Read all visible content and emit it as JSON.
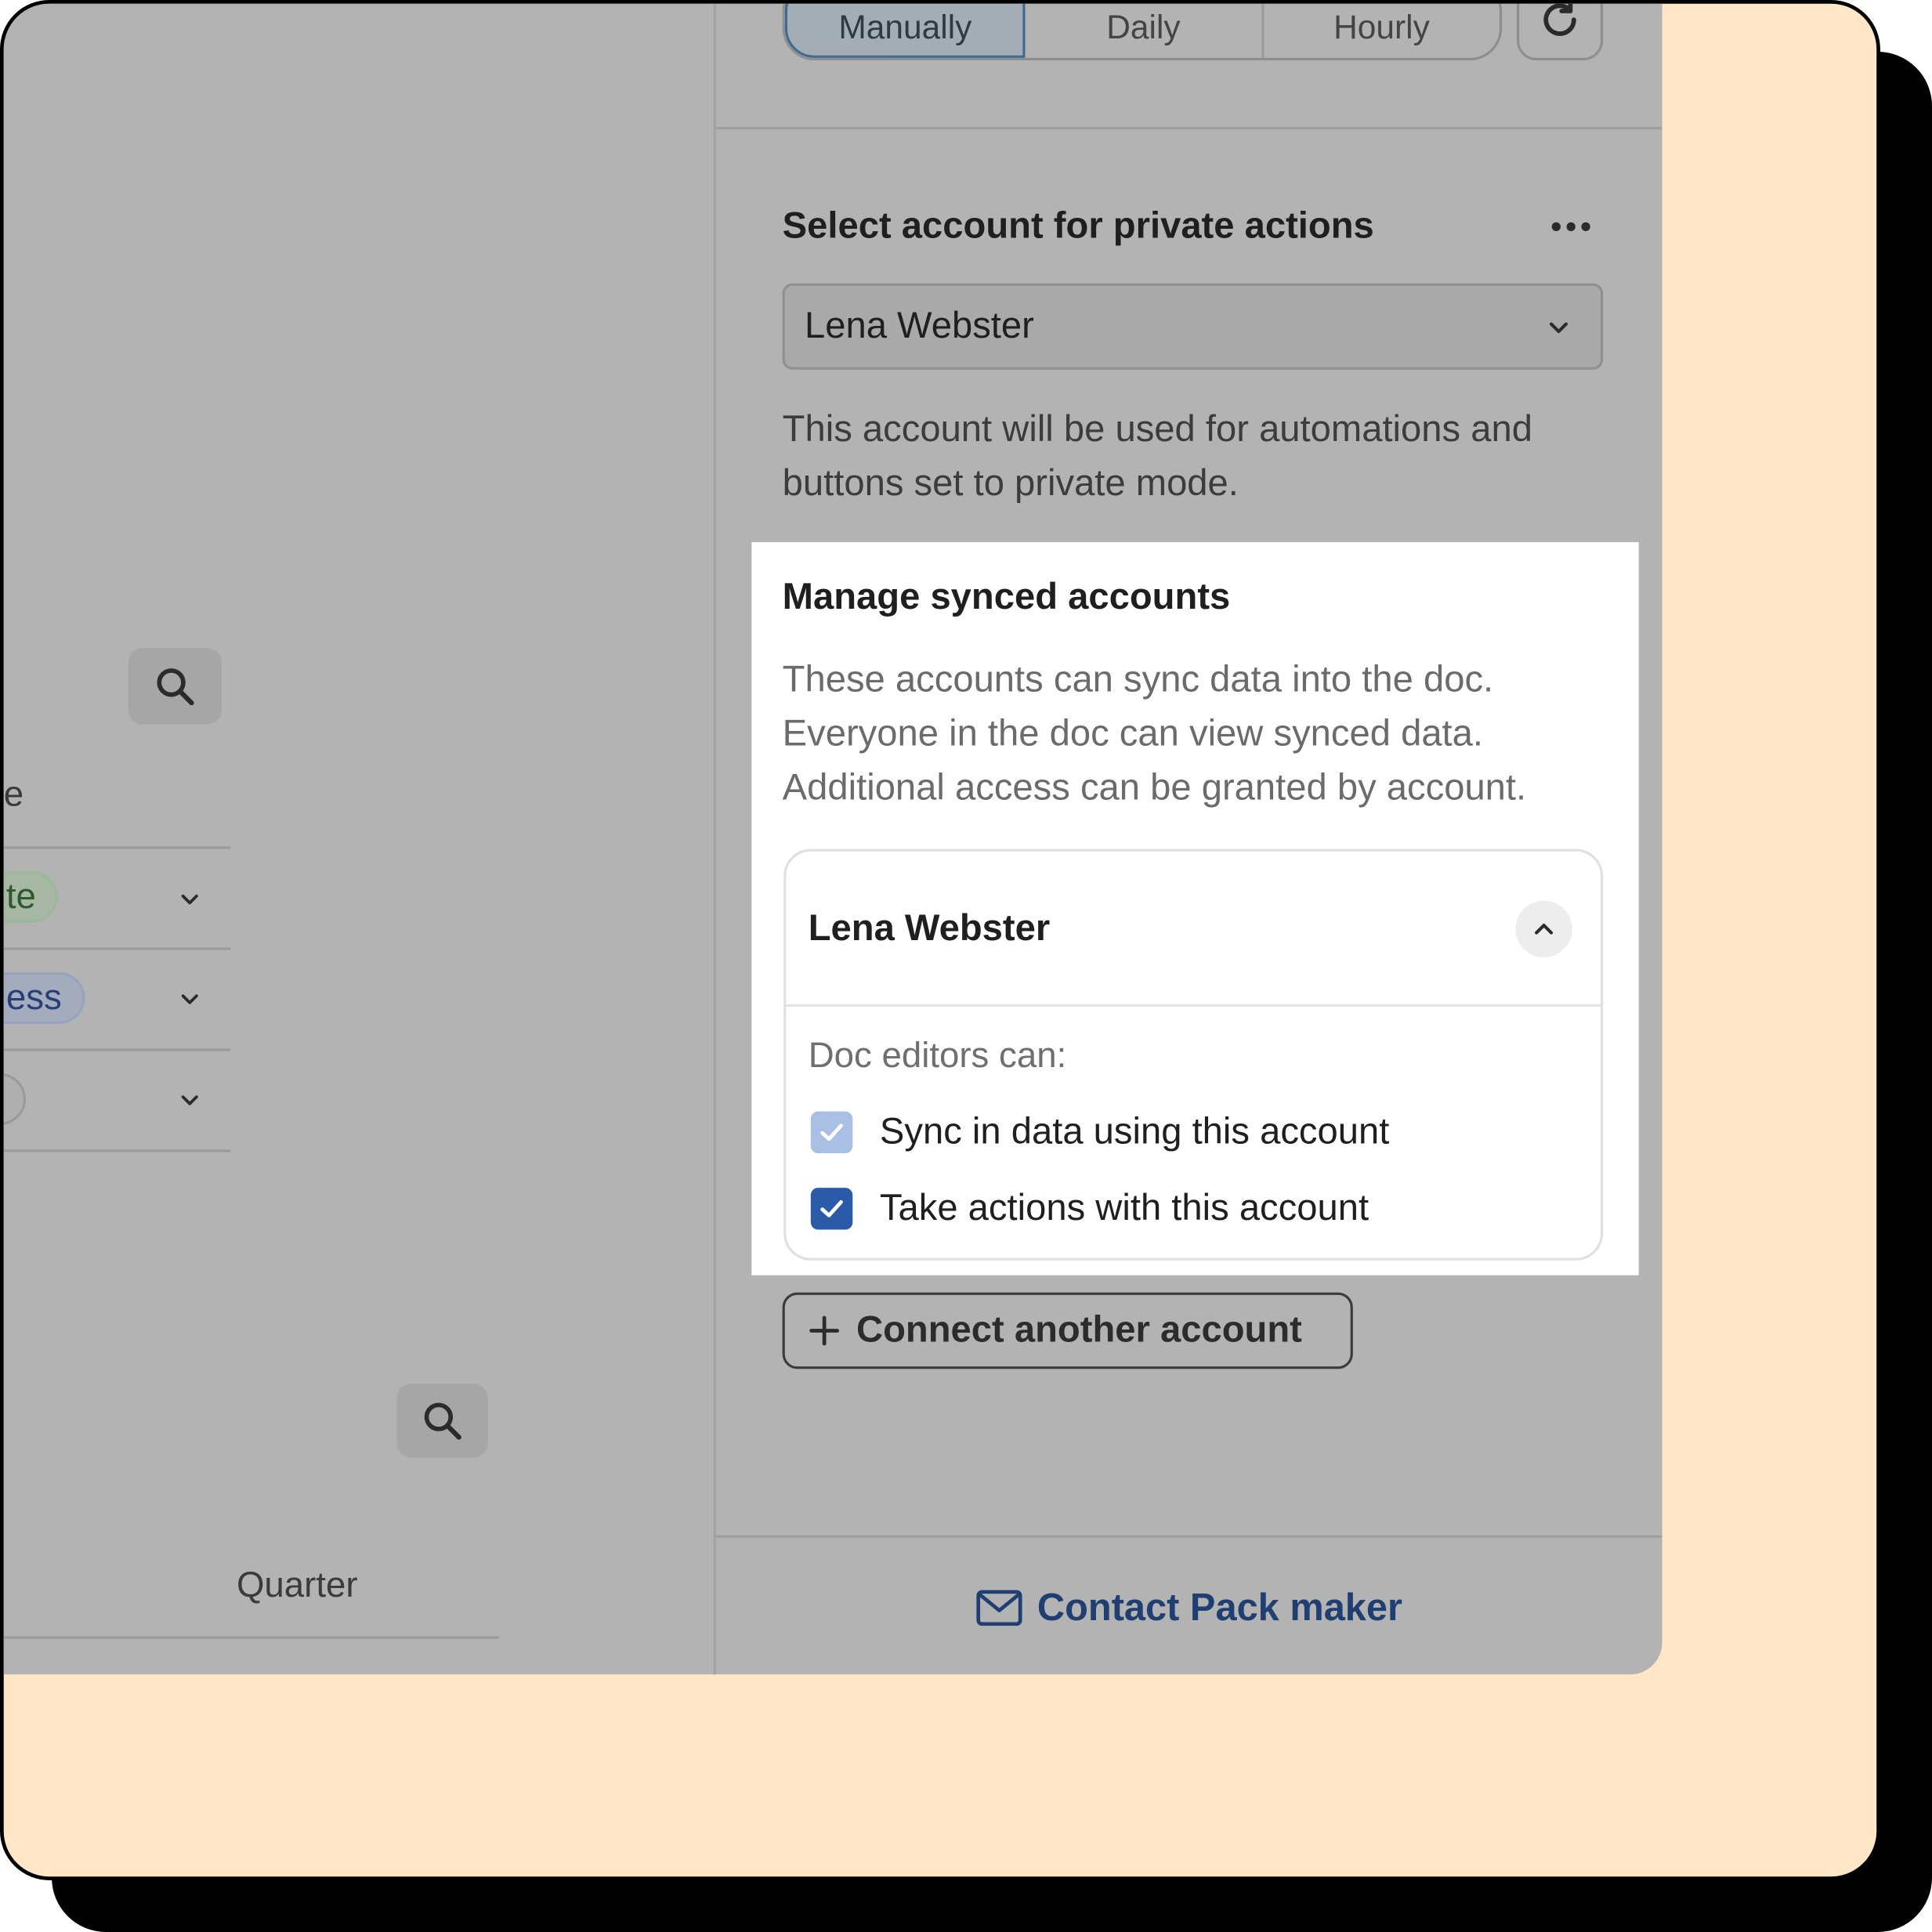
{
  "sync_frequency": {
    "options": [
      "Manually",
      "Daily",
      "Hourly"
    ],
    "selected": "Manually"
  },
  "icons": {
    "refresh": "refresh-icon",
    "more": "more-horizontal-icon",
    "search": "search-icon",
    "chevron": "chevron-down-icon",
    "collapse": "chevron-up-icon",
    "check": "check-icon",
    "plus": "plus-icon",
    "mail": "mail-icon"
  },
  "private_actions": {
    "title": "Select account for private actions",
    "selected_account": "Lena Webster",
    "help_text": "This account will be used for automations and buttons set to private mode."
  },
  "synced_accounts": {
    "title": "Manage synced accounts",
    "description": "These accounts can sync data into the doc. Everyone in the doc can view synced data. Additional access can be granted by account.",
    "account": {
      "name": "Lena Webster",
      "expanded": true,
      "editors_label": "Doc editors can:",
      "permissions": [
        {
          "label": "Sync in data using this account",
          "checked": true,
          "disabled": true
        },
        {
          "label": "Take actions with this account",
          "checked": true,
          "disabled": false
        }
      ]
    },
    "connect_label": "Connect another account"
  },
  "footer": {
    "contact_label": "Contact Pack maker"
  },
  "background_table": {
    "column_partial": "e",
    "pill_1": "te",
    "pill_2": "ess",
    "column_header": "Quarter"
  },
  "colors": {
    "frame_bg": "#FFE6C7",
    "overlay": "#B3B3B3",
    "accent": "#2B5BA8",
    "link": "#1F3F72"
  }
}
